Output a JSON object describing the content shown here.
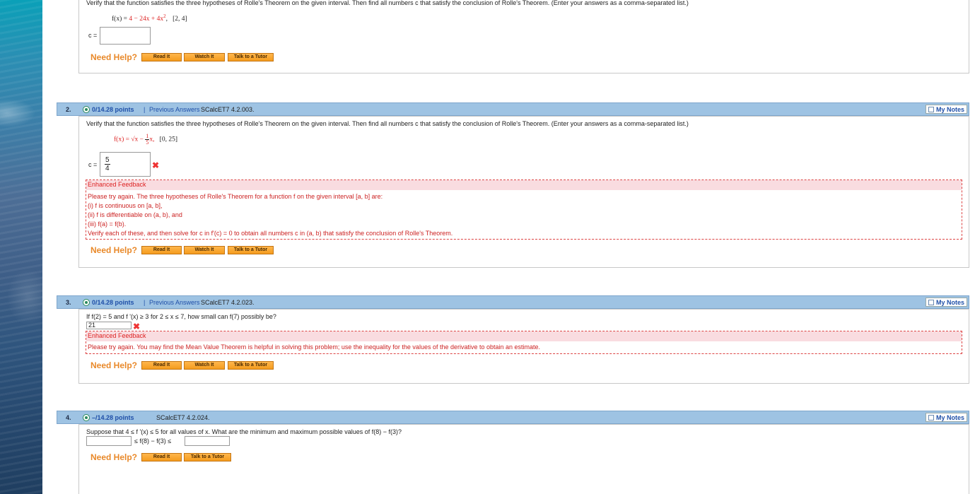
{
  "q1": {
    "prompt": "Verify that the function satisfies the three hypotheses of Rolle's Theorem on the given interval. Then find all numbers c that satisfy the conclusion of Rolle's Theorem. (Enter your answers as a comma-separated list.)",
    "func_lhs": "f(x) = ",
    "func_rhs_a": "4 − 24x + 4x",
    "func_exp": "2",
    "interval": "[2, 4]",
    "c_label": "c =",
    "answer": ""
  },
  "q2": {
    "num": "2.",
    "points": "0/14.28 points",
    "sep": "|",
    "prev": "Previous Answers",
    "code": "SCalcET7 4.2.003.",
    "notes": "My Notes",
    "prompt": "Verify that the function satisfies the three hypotheses of Rolle's Theorem on the given interval. Then find all numbers c that satisfy the conclusion of Rolle's Theorem. (Enter your answers as a comma-separated list.)",
    "func": "f(x) = √x − ",
    "frac_n": "1",
    "frac_d": "5",
    "func_tail": "x,",
    "interval": "[0, 25]",
    "c_label": "c =",
    "ans_n": "5",
    "ans_d": "4",
    "fb_title": "Enhanced Feedback",
    "fb_lines": [
      "Please try again. The three hypotheses of Rolle's Theorem for a function f on the given interval  [a, b]  are:",
      "(i)  f  is continuous on  [a, b],",
      "(ii)  f  is differentiable on  (a, b),  and",
      "(iii)  f(a) = f(b).",
      "Verify each of these, and then solve for  c  in  f'(c) = 0  to obtain all numbers c in  (a, b)  that satisfy the conclusion of Rolle's Theorem."
    ]
  },
  "q3": {
    "num": "3.",
    "points": "0/14.28 points",
    "sep": "|",
    "prev": "Previous Answers",
    "code": "SCalcET7 4.2.023.",
    "notes": "My Notes",
    "prompt": "If f(2) = 5 and f '(x) ≥ 3 for 2 ≤ x ≤ 7, how small can f(7) possibly be?",
    "answer": "21",
    "fb_title": "Enhanced Feedback",
    "fb_line": "Please try again. You may find the Mean Value Theorem is helpful in solving this problem; use the inequality for the values of the derivative to obtain an estimate."
  },
  "q4": {
    "num": "4.",
    "points": "–/14.28 points",
    "code": "SCalcET7 4.2.024.",
    "notes": "My Notes",
    "prompt": "Suppose that 4 ≤ f '(x) ≤ 5 for all values of x. What are the minimum and maximum possible values of  f(8) − f(3)?",
    "mid": "≤ f(8) − f(3) ≤"
  },
  "help": {
    "label": "Need Help?",
    "read": "Read It",
    "watch": "Watch It",
    "tutor": "Talk to a Tutor"
  },
  "colors": {
    "accent": "#e9892a",
    "header": "#9ec3e3",
    "link": "#1f4fa8",
    "error": "#dd2222"
  }
}
